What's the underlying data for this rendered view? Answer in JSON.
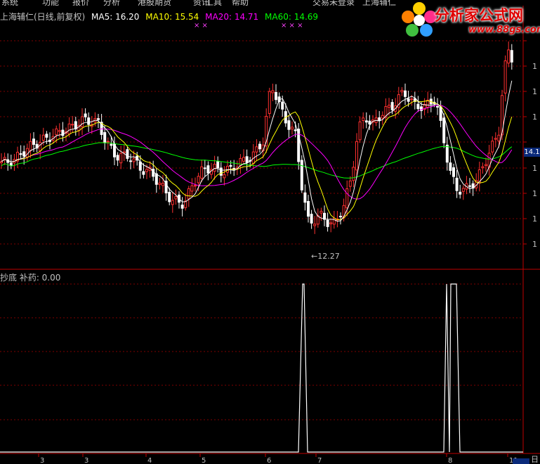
{
  "menu": [
    "系统",
    "功能",
    "报价",
    "分析",
    "港股期货",
    "资讯",
    "工具",
    "帮助"
  ],
  "menu_right": [
    "交易未登录",
    "上海辅仁"
  ],
  "title": {
    "stock": "上海辅仁(日线,前复权)",
    "ma5": "MA5: 16.20",
    "ma10": "MA10: 15.54",
    "ma20": "MA20: 14.71",
    "ma60": "MA60: 14.69"
  },
  "colors": {
    "ma5": "#ffffff",
    "ma10": "#ffff00",
    "ma20": "#ff00ff",
    "ma60": "#00ff00",
    "up": "#ff3030",
    "down": "#ffffff",
    "grid": "#800000",
    "indicator": "#ffffff"
  },
  "marks": [
    "× ×",
    "× × ×"
  ],
  "low_label": "12.27",
  "price_tag": "14.1",
  "y_ticks": [
    "1",
    "1",
    "1",
    "1",
    "1",
    "1",
    "1",
    "1"
  ],
  "subchart_label": "抄底 补药: 0.00",
  "x_axis": [
    "3",
    "3",
    "4",
    "5",
    "6",
    "7",
    "8",
    "11"
  ],
  "logo": {
    "text": "分析家公式网",
    "url": "www.88gs.com"
  },
  "corner_label": "日"
}
